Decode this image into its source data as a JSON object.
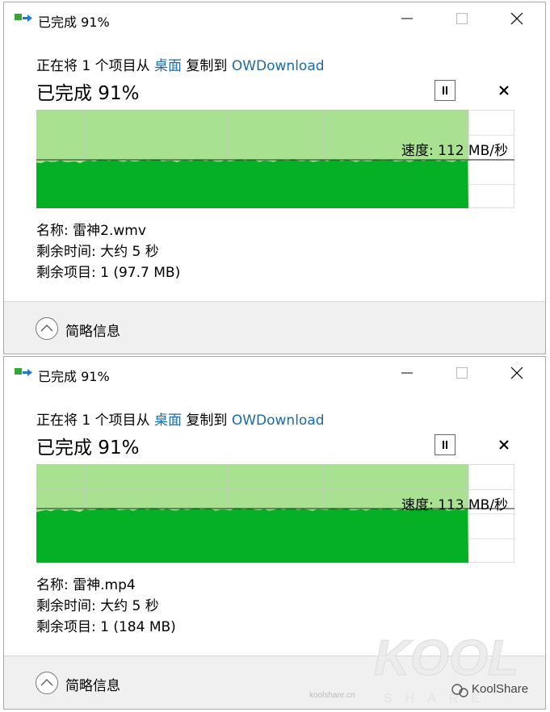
{
  "dialogs": [
    {
      "title": "已完成 91%",
      "desc": {
        "prefix": "正在将 1 个项目从 ",
        "source": "桌面",
        "middle": " 复制到 ",
        "dest": "OWDownload"
      },
      "status": "已完成 91%",
      "progress": 0.91,
      "speed": "速度: 112 MB/秒",
      "name": "名称: 雷神2.wmv",
      "time_left": "剩余时间: 大约 5 秒",
      "items_left": "剩余项目: 1 (97.7 MB)",
      "more_label": "简略信息"
    },
    {
      "title": "已完成 91%",
      "desc": {
        "prefix": "正在将 1 个项目从 ",
        "source": "桌面",
        "middle": " 复制到 ",
        "dest": "OWDownload"
      },
      "status": "已完成 91%",
      "progress": 0.91,
      "speed": "速度: 113 MB/秒",
      "name": "名称: 雷神.mp4",
      "time_left": "剩余时间: 大约 5 秒",
      "items_left": "剩余项目: 1 (184 MB)",
      "more_label": "简略信息"
    }
  ],
  "colors": {
    "progress_fill": "#a8e291",
    "graph_fill": "#06b025",
    "grid": "#c8c8c8",
    "link": "#1a6aa7"
  },
  "icons": [
    "copy-app-icon",
    "minimize-icon",
    "maximize-icon",
    "close-icon",
    "pause-icon",
    "cancel-icon",
    "chevron-up-icon"
  ],
  "watermark": {
    "logo": "KOOL SHARE",
    "site": "koolshare.cn",
    "wechat": "KoolShare"
  }
}
